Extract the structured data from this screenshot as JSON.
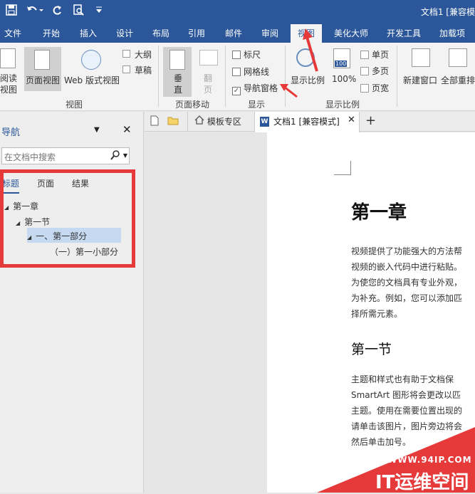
{
  "titlebar": {
    "doc_title": "文档1 [兼容模"
  },
  "tabs": [
    {
      "label": "文件"
    },
    {
      "label": "开始"
    },
    {
      "label": "插入"
    },
    {
      "label": "设计"
    },
    {
      "label": "布局"
    },
    {
      "label": "引用"
    },
    {
      "label": "邮件"
    },
    {
      "label": "审阅"
    },
    {
      "label": "视图"
    },
    {
      "label": "美化大师"
    },
    {
      "label": "开发工具"
    },
    {
      "label": "加载项"
    }
  ],
  "ribbon": {
    "views": {
      "read_mode": "阅读\n视图",
      "print_layout": "页面视图",
      "web_layout": "Web 版式视图",
      "outline": "大纲",
      "draft": "草稿",
      "group": "视图"
    },
    "page_move": {
      "vertical": "垂\n直",
      "side": "翻\n页",
      "group": "页面移动"
    },
    "show": {
      "ruler": "标尺",
      "gridlines": "网格线",
      "nav_pane": "导航窗格",
      "nav_pane_checked": "✓",
      "group": "显示"
    },
    "zoom": {
      "zoom": "显示比例",
      "hundred": "100%",
      "hundred_icon": "100",
      "one_page": "单页",
      "multi_page": "多页",
      "page_width": "页宽",
      "group": "显示比例"
    },
    "window": {
      "new_window": "新建窗口",
      "arrange_all": "全部重排"
    }
  },
  "nav_pane": {
    "title": "导航",
    "search_placeholder": "在文档中搜索",
    "tabs": [
      "标题",
      "页面",
      "结果"
    ],
    "tree": [
      {
        "label": "第一章",
        "level": 0
      },
      {
        "label": "第一节",
        "level": 1
      },
      {
        "label": "一、第一部分",
        "level": 2,
        "selected": true
      },
      {
        "label": "（一）第一小部分",
        "level": 3
      }
    ]
  },
  "doc_tabs": {
    "template": "模板专区",
    "document": "文档1 [兼容模式]",
    "word_icon": "W"
  },
  "document": {
    "heading1": "第一章",
    "para1": [
      "视频提供了功能强大的方法帮",
      "视频的嵌入代码中进行粘贴。",
      "为使您的文档具有专业外观，",
      "为补充。例如，您可以添加匹",
      "择所需元素。"
    ],
    "heading2": "第一节",
    "para2": [
      "主题和样式也有助于文档保",
      "SmartArt 图形将会更改以匹",
      "主题。使用在需要位置出现的",
      "请单击该图片，图片旁边将会",
      "然后单击加号。"
    ]
  },
  "watermark": {
    "url": "WWW.94IP.COM",
    "brand": "IT运维空间"
  },
  "colors": {
    "brand_blue": "#2b579a",
    "highlight_red": "#e63a3a",
    "selection": "#c5d9f1"
  }
}
